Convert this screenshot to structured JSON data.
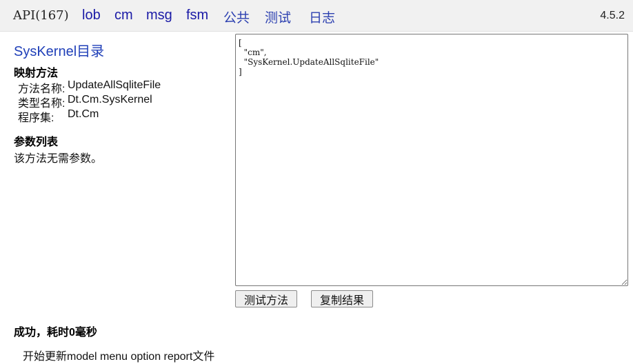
{
  "header": {
    "api_title": "API(167)",
    "nav": [
      {
        "label": "lob",
        "cjk": false
      },
      {
        "label": "cm",
        "cjk": false
      },
      {
        "label": "msg",
        "cjk": false
      },
      {
        "label": "fsm",
        "cjk": false
      },
      {
        "label": "公共",
        "cjk": true
      },
      {
        "label": "测试",
        "cjk": true
      },
      {
        "label": "日志",
        "cjk": true
      }
    ],
    "version": "4.5.2"
  },
  "left": {
    "title": "SysKernel目录",
    "mapping_heading": "映射方法",
    "method_label": "方法名称:",
    "method_value": "UpdateAllSqliteFile",
    "type_label": "类型名称:",
    "type_value": "Dt.Cm.SysKernel",
    "assembly_label": "程序集:",
    "assembly_value": "Dt.Cm",
    "params_heading": "参数列表",
    "params_text": "该方法无需参数。"
  },
  "editor": {
    "content": "[\n  \"cm\",\n  \"SysKernel.UpdateAllSqliteFile\"\n]"
  },
  "buttons": {
    "test": "测试方法",
    "copy": "复制结果"
  },
  "result": {
    "title": "成功，耗时0毫秒",
    "log": "开始更新model menu option report文件"
  },
  "colors": {
    "link": "#1a1aa6",
    "title": "#1f3fb8",
    "topbar": "#f1f1f1"
  }
}
